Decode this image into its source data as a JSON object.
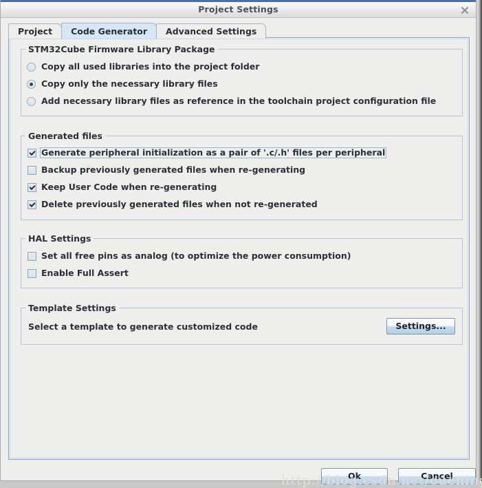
{
  "window": {
    "title": "Project Settings",
    "close_icon": "close-icon"
  },
  "tabs": [
    {
      "label": "Project",
      "active": false
    },
    {
      "label": "Code Generator",
      "active": true
    },
    {
      "label": "Advanced Settings",
      "active": false
    }
  ],
  "groups": {
    "firmware": {
      "title": "STM32Cube Firmware Library Package",
      "options": [
        {
          "label": "Copy all used libraries into the project folder",
          "checked": false
        },
        {
          "label": "Copy only the necessary library files",
          "checked": true
        },
        {
          "label": "Add necessary library files as reference in the toolchain project configuration file",
          "checked": false
        }
      ]
    },
    "generated_files": {
      "title": "Generated files",
      "options": [
        {
          "label": "Generate peripheral initialization as a pair of '.c/.h' files per peripheral",
          "checked": true,
          "focused": true
        },
        {
          "label": "Backup previously generated files when re-generating",
          "checked": false,
          "focused": false
        },
        {
          "label": "Keep User Code when re-generating",
          "checked": true,
          "focused": false
        },
        {
          "label": "Delete previously generated files when not re-generated",
          "checked": true,
          "focused": false
        }
      ]
    },
    "hal": {
      "title": "HAL Settings",
      "options": [
        {
          "label": "Set all free pins as analog (to optimize the power consumption)",
          "checked": false
        },
        {
          "label": "Enable Full Assert",
          "checked": false
        }
      ]
    },
    "template": {
      "title": "Template Settings",
      "description": "Select a template to generate customized code",
      "settings_button_label": "Settings..."
    }
  },
  "footer": {
    "ok_label": "Ok",
    "cancel_label": "Cancel"
  },
  "watermark": {
    "text": "http://blog.csdn.net/ouening"
  },
  "colors": {
    "accent": "#4a6ea9",
    "active_tab": "#d6e6f7",
    "panel_bg": "#eeeeec",
    "group_border": "#b3c6dc",
    "button_gradient_bottom": "#b6cfe8"
  }
}
